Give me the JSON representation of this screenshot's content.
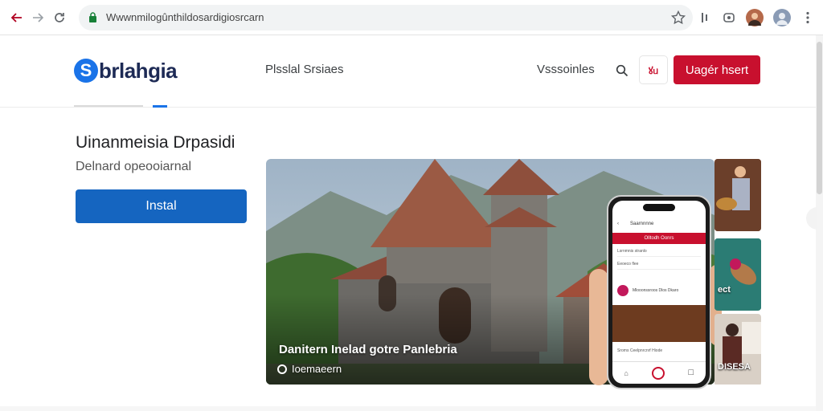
{
  "browser": {
    "url": "Wwwnmilogûnthildosardigiosrcarn",
    "back_icon": "arrow-left-icon",
    "forward_icon": "arrow-right-icon",
    "reload_icon": "reload-icon"
  },
  "header": {
    "logo_mark": "S",
    "logo_text": "brlahgia",
    "nav_link_left": "Plsslal Srsiaes",
    "nav_link_right": "Vsssoinles",
    "cart_label": "ꙋᥙ",
    "cta_label": "Uagér hsert"
  },
  "hero": {
    "title": "Uinanmeisia Drpasidi",
    "subtitle": "Delnard opeooiarnal",
    "install_label": "Instal"
  },
  "feature": {
    "caption": "Danitern Inelad gotre Panlebria",
    "meta": "Ioemaeern"
  },
  "phone": {
    "app_title": "Saarnnnne",
    "banner": "Olltodh Oonrs",
    "row1": "Lsrnmnis stranlo",
    "row2": "Eeoeco flee",
    "item_text": "Mlooonssroos  Dlos  Dkaro",
    "list_text": "Sroms  Ceelpnrcnrf  Hiode"
  },
  "thumbs": {
    "label2": "ect",
    "label3": "DISESA"
  },
  "colors": {
    "accent_red": "#c8102e",
    "accent_blue": "#1565c0",
    "logo_blue": "#1a73e8"
  }
}
